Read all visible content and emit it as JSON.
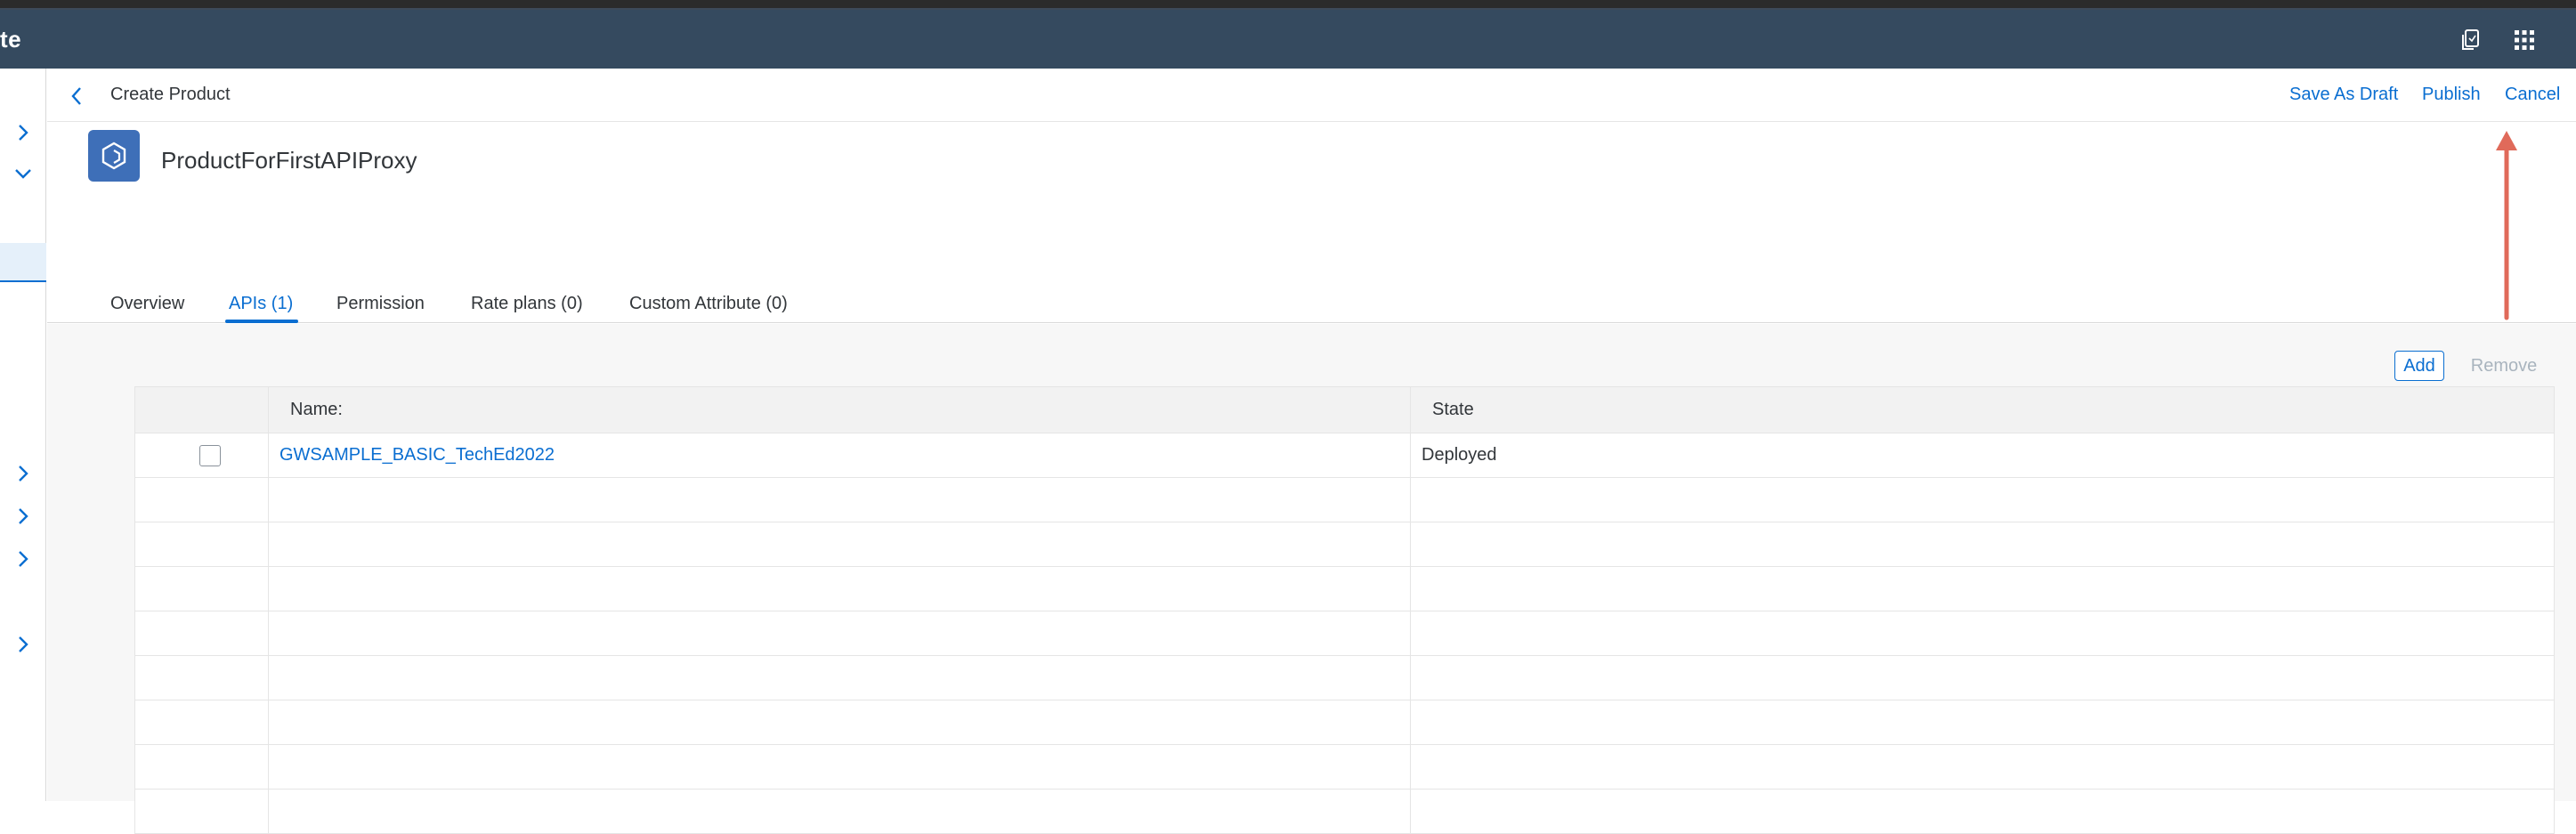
{
  "shell": {
    "title": "te",
    "icons": [
      "copy-icon",
      "app-grid-icon"
    ]
  },
  "header": {
    "title": "Create Product",
    "actions": {
      "save_as_draft": "Save As Draft",
      "publish": "Publish",
      "cancel": "Cancel"
    }
  },
  "product": {
    "name": "ProductForFirstAPIProxy"
  },
  "tabs": [
    {
      "label": "Overview",
      "active": false
    },
    {
      "label": "APIs (1)",
      "active": true
    },
    {
      "label": "Permission",
      "active": false
    },
    {
      "label": "Rate plans (0)",
      "active": false
    },
    {
      "label": "Custom Attribute (0)",
      "active": false
    }
  ],
  "toolbar": {
    "add": "Add",
    "remove": "Remove"
  },
  "table": {
    "columns": [
      "Name:",
      "State"
    ],
    "rows": [
      {
        "name": "GWSAMPLE_BASIC_TechEd2022",
        "state": "Deployed"
      }
    ]
  },
  "colors": {
    "shell": "#354a5f",
    "accent": "#0a6ed1",
    "annotation_arrow": "#e06a5a"
  }
}
